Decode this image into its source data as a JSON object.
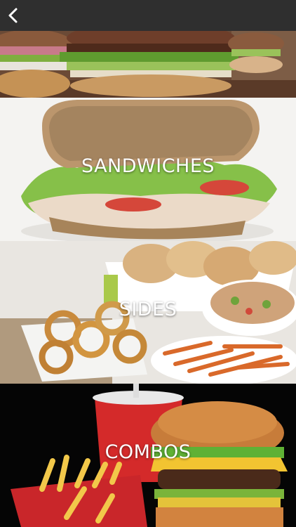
{
  "navbar": {
    "back_icon": "chevron-left-icon",
    "background": "#2f2f2f"
  },
  "categories": [
    {
      "label": "",
      "image": "burger-photo"
    },
    {
      "label": "SANDWICHES",
      "image": "sandwich-photo"
    },
    {
      "label": "SIDES",
      "image": "sides-photo"
    },
    {
      "label": "COMBOS",
      "image": "combo-meal-photo"
    }
  ],
  "colors": {
    "label_text": "#ffffff",
    "navbar": "#2f2f2f"
  }
}
